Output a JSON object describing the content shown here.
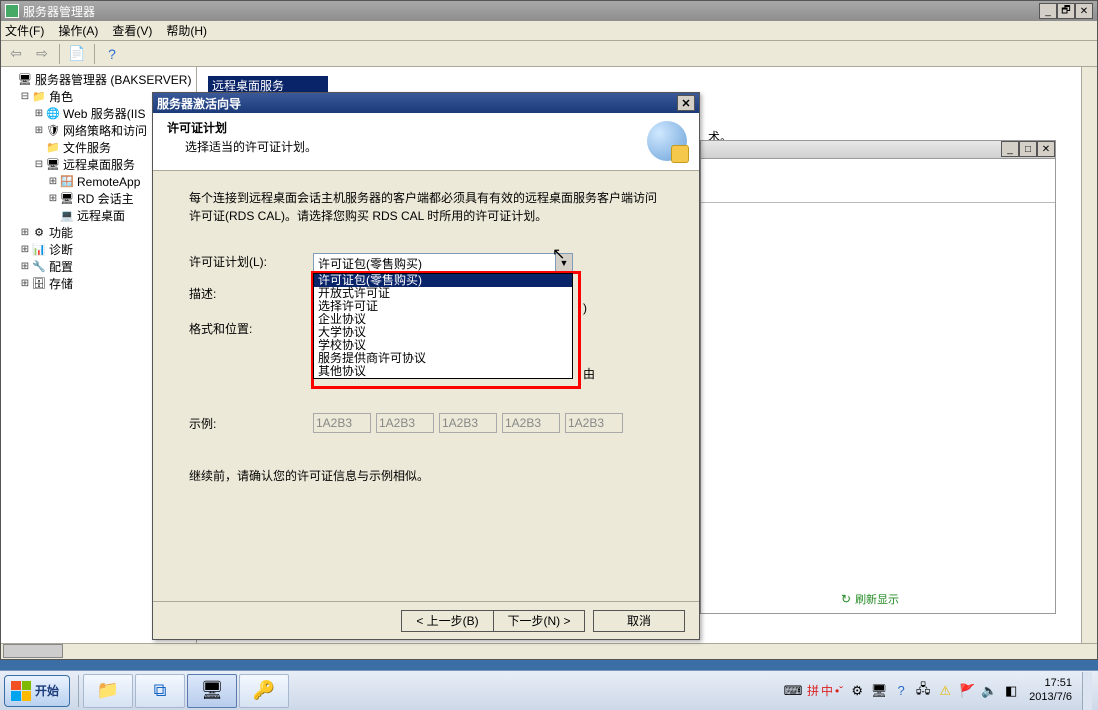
{
  "app": {
    "title": "服务器管理器",
    "menus": {
      "file": "文件(F)",
      "action": "操作(A)",
      "view": "查看(V)",
      "help": "帮助(H)"
    }
  },
  "tree": {
    "root": "服务器管理器 (BAKSERVER)",
    "roles": "角色",
    "iis": "Web 服务器(IIS",
    "nps": "网络策略和访问",
    "file": "文件服务",
    "rds": "远程桌面服务",
    "remoteapp": "RemoteApp",
    "rd_session": "RD 会话主",
    "rd_desktop": "远程桌面",
    "features": "功能",
    "diag": "诊断",
    "config": "配置",
    "storage": "存储"
  },
  "mdi_child_title": "远程桌面服务",
  "stray": "术。",
  "embed": {
    "footer_link": "刷新显示"
  },
  "dialog": {
    "title": "服务器激活向导",
    "header_title": "许可证计划",
    "header_sub": "选择适当的许可证计划。",
    "intro": "每个连接到远程桌面会话主机服务器的客户端都必须具有有效的远程桌面服务客户端访问许可证(RDS CAL)。请选择您购买 RDS CAL 时所用的许可证计划。",
    "label_plan": "许可证计划(L):",
    "label_desc": "描述:",
    "label_format": "格式和位置:",
    "combo_selected": "许可证包(零售购买)",
    "options": {
      "o0": "许可证包(零售购买)",
      "o1": "开放式许可证",
      "o2": "选择许可证",
      "o3": "企业协议",
      "o4": "大学协议",
      "o5": "学校协议",
      "o6": "服务提供商许可协议",
      "o7": "其他协议"
    },
    "side_desc_tail": ")",
    "side_format_tail": "由",
    "example_label": "示例:",
    "example_value": "1A2B3",
    "confirm": "继续前，请确认您的许可证信息与示例相似。",
    "btn_prev": "< 上一步(B)",
    "btn_next": "下一步(N) >",
    "btn_cancel": "取消"
  },
  "taskbar": {
    "start": "开始",
    "ime": "中",
    "clock_time": "17:51",
    "clock_date": "2013/7/6"
  }
}
